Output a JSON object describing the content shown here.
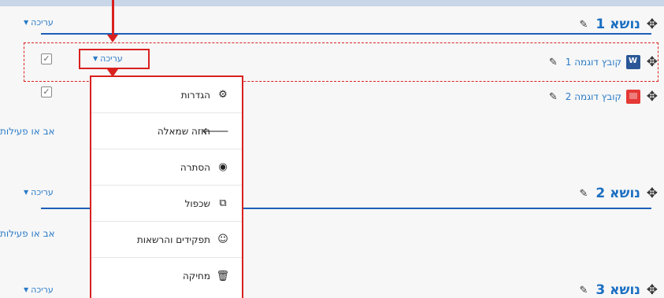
{
  "colors": {
    "accent": "#2a7bc7",
    "highlight": "#d9211e",
    "section_line": "#1d5fb8"
  },
  "edit_label": "עריכה",
  "add_activity_label": "אב או פעילות",
  "sections": [
    {
      "title": "נושא 1"
    },
    {
      "title": "נושא 2"
    },
    {
      "title": "נושא 3"
    }
  ],
  "activities": [
    {
      "name": "קובץ דוגמה 1",
      "icon": "word-file-icon"
    },
    {
      "name": "קובץ דוגמה 2",
      "icon": "pdf-file-icon"
    }
  ],
  "dropdown": {
    "items": [
      {
        "label": "הגדרות",
        "icon": "gear-icon",
        "glyph": "⚙"
      },
      {
        "label": "הזזה שמאלה",
        "icon": "arrow-left-icon",
        "glyph": "🡐"
      },
      {
        "label": "הסתרה",
        "icon": "eye-icon",
        "glyph": "◉"
      },
      {
        "label": "שכפול",
        "icon": "duplicate-icon",
        "glyph": "⧉"
      },
      {
        "label": "תפקידים והרשאות",
        "icon": "user-icon",
        "glyph": "☺"
      },
      {
        "label": "מחיקה",
        "icon": "trash-icon",
        "glyph": "🗑"
      }
    ]
  }
}
